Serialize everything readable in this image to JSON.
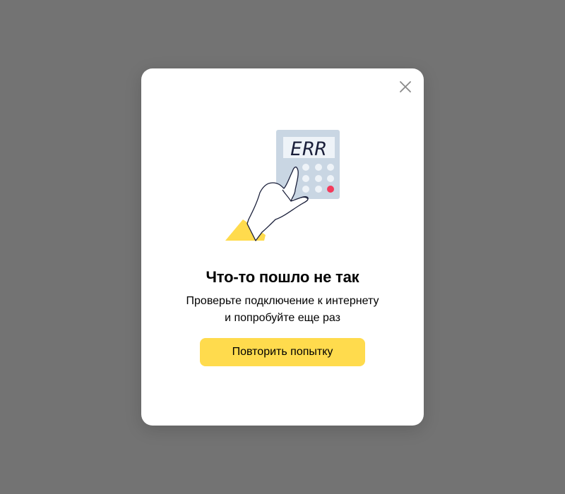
{
  "modal": {
    "close_icon": "close-icon",
    "illustration": {
      "display_text": "ERR",
      "icon": "calculator-error-illustration"
    },
    "title": "Что-то пошло не так",
    "subtitle_line1": "Проверьте подключение к интернету",
    "subtitle_line2": "и попробуйте еще раз",
    "retry_label": "Повторить попытку"
  },
  "colors": {
    "backdrop": "#737373",
    "modal_bg": "#ffffff",
    "accent": "#ffdb4d",
    "calculator": "#c9d6e3",
    "error_key": "#f33a5b"
  }
}
